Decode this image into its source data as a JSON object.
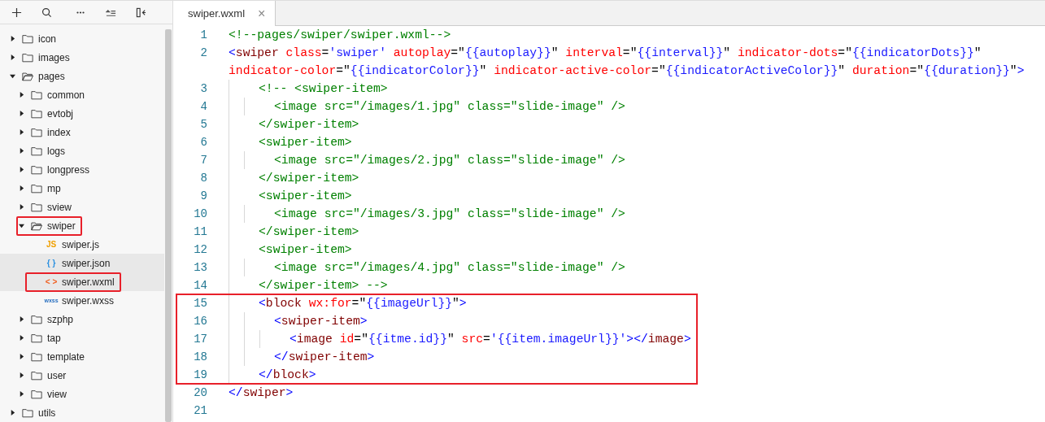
{
  "sidebar": {
    "toolbar": [
      {
        "kind": "add"
      },
      {
        "kind": "search"
      },
      {
        "kind": "more"
      },
      {
        "kind": "collapse"
      },
      {
        "kind": "toggle"
      }
    ],
    "tree": [
      {
        "label": "icon",
        "kind": "folder",
        "expanded": false,
        "selected": false,
        "marked": false
      },
      {
        "label": "images",
        "kind": "folder",
        "expanded": false,
        "selected": false,
        "marked": false
      },
      {
        "label": "pages",
        "kind": "folder",
        "expanded": true,
        "selected": false,
        "marked": false,
        "children": [
          {
            "label": "common",
            "kind": "folder",
            "expanded": false,
            "selected": false,
            "marked": false
          },
          {
            "label": "evtobj",
            "kind": "folder",
            "expanded": false,
            "selected": false,
            "marked": false
          },
          {
            "label": "index",
            "kind": "folder",
            "expanded": false,
            "selected": false,
            "marked": false
          },
          {
            "label": "logs",
            "kind": "folder",
            "expanded": false,
            "selected": false,
            "marked": false
          },
          {
            "label": "longpress",
            "kind": "folder",
            "expanded": false,
            "selected": false,
            "marked": false
          },
          {
            "label": "mp",
            "kind": "folder",
            "expanded": false,
            "selected": false,
            "marked": false
          },
          {
            "label": "sview",
            "kind": "folder",
            "expanded": false,
            "selected": false,
            "marked": false
          },
          {
            "label": "swiper",
            "kind": "folder",
            "expanded": true,
            "selected": false,
            "marked": true,
            "children": [
              {
                "label": "swiper.js",
                "kind": "js",
                "icon": "JS",
                "selected": false,
                "marked": false
              },
              {
                "label": "swiper.json",
                "kind": "json",
                "icon": "{ }",
                "selected": true,
                "marked": false
              },
              {
                "label": "swiper.wxml",
                "kind": "wxml",
                "icon": "< >",
                "selected": true,
                "marked": true
              },
              {
                "label": "swiper.wxss",
                "kind": "wxss",
                "icon": "wxss",
                "selected": false,
                "marked": false
              }
            ]
          },
          {
            "label": "szphp",
            "kind": "folder",
            "expanded": false,
            "selected": false,
            "marked": false
          },
          {
            "label": "tap",
            "kind": "folder",
            "expanded": false,
            "selected": false,
            "marked": false
          },
          {
            "label": "template",
            "kind": "folder",
            "expanded": false,
            "selected": false,
            "marked": false
          },
          {
            "label": "user",
            "kind": "folder",
            "expanded": false,
            "selected": false,
            "marked": false
          },
          {
            "label": "view",
            "kind": "folder",
            "expanded": false,
            "selected": false,
            "marked": false
          }
        ]
      },
      {
        "label": "utils",
        "kind": "folder",
        "expanded": false,
        "selected": false,
        "marked": false
      }
    ]
  },
  "tabs": [
    {
      "label": "swiper.wxml",
      "close": "×",
      "selected": true
    }
  ],
  "editor": {
    "lines": [
      {
        "number": "1",
        "boxed": false,
        "tokens": [
          {
            "kind": "c",
            "text": "<!--pages/swiper/swiper.wxml-->"
          }
        ]
      },
      {
        "number": "2",
        "boxed": false,
        "tokens": [
          {
            "kind": "p",
            "text": "<"
          },
          {
            "kind": "t",
            "text": "swiper"
          },
          {
            "kind": "a",
            "text": " class"
          },
          {
            "kind": "o",
            "text": "="
          },
          {
            "kind": "s",
            "text": "'swiper'"
          },
          {
            "kind": "a",
            "text": " autoplay"
          },
          {
            "kind": "o",
            "text": "=\""
          },
          {
            "kind": "s",
            "text": "{{autoplay}}"
          },
          {
            "kind": "o",
            "text": "\""
          },
          {
            "kind": "a",
            "text": " interval"
          },
          {
            "kind": "o",
            "text": "=\""
          },
          {
            "kind": "s",
            "text": "{{interval}}"
          },
          {
            "kind": "o",
            "text": "\""
          },
          {
            "kind": "a",
            "text": " indicator-dots"
          },
          {
            "kind": "o",
            "text": "=\""
          },
          {
            "kind": "s",
            "text": "{{indicatorDots}}"
          },
          {
            "kind": "o",
            "text": "\""
          },
          {
            "kind": "a",
            "text": " indicator-color"
          },
          {
            "kind": "o",
            "text": "=\""
          },
          {
            "kind": "s",
            "text": "{{indicatorColor}}"
          },
          {
            "kind": "o",
            "text": "\""
          },
          {
            "kind": "a",
            "text": " indicator-active-color"
          },
          {
            "kind": "o",
            "text": "=\""
          },
          {
            "kind": "s",
            "text": "{{indicatorActiveColor}}"
          },
          {
            "kind": "o",
            "text": "\""
          },
          {
            "kind": "a",
            "text": " duration"
          },
          {
            "kind": "o",
            "text": "=\""
          },
          {
            "kind": "s",
            "text": "{{duration}}"
          },
          {
            "kind": "o",
            "text": "\""
          },
          {
            "kind": "p",
            "text": ">"
          }
        ]
      },
      {
        "number": "3",
        "boxed": false,
        "tokens": [
          {
            "kind": "c",
            "text": "    <!-- <swiper-item>"
          }
        ]
      },
      {
        "number": "4",
        "boxed": false,
        "tokens": [
          {
            "kind": "c",
            "text": "      <image src=\"/images/1.jpg\" class=\"slide-image\" />"
          }
        ]
      },
      {
        "number": "5",
        "boxed": false,
        "tokens": [
          {
            "kind": "c",
            "text": "    </swiper-item>"
          }
        ]
      },
      {
        "number": "6",
        "boxed": false,
        "tokens": [
          {
            "kind": "c",
            "text": "    <swiper-item>"
          }
        ]
      },
      {
        "number": "7",
        "boxed": false,
        "tokens": [
          {
            "kind": "c",
            "text": "      <image src=\"/images/2.jpg\" class=\"slide-image\" />"
          }
        ]
      },
      {
        "number": "8",
        "boxed": false,
        "tokens": [
          {
            "kind": "c",
            "text": "    </swiper-item>"
          }
        ]
      },
      {
        "number": "9",
        "boxed": false,
        "tokens": [
          {
            "kind": "c",
            "text": "    <swiper-item>"
          }
        ]
      },
      {
        "number": "10",
        "boxed": false,
        "tokens": [
          {
            "kind": "c",
            "text": "      <image src=\"/images/3.jpg\" class=\"slide-image\" />"
          }
        ]
      },
      {
        "number": "11",
        "boxed": false,
        "tokens": [
          {
            "kind": "c",
            "text": "    </swiper-item>"
          }
        ]
      },
      {
        "number": "12",
        "boxed": false,
        "tokens": [
          {
            "kind": "c",
            "text": "    <swiper-item>"
          }
        ]
      },
      {
        "number": "13",
        "boxed": false,
        "tokens": [
          {
            "kind": "c",
            "text": "      <image src=\"/images/4.jpg\" class=\"slide-image\" />"
          }
        ]
      },
      {
        "number": "14",
        "boxed": false,
        "tokens": [
          {
            "kind": "c",
            "text": "    </swiper-item> -->"
          }
        ]
      },
      {
        "number": "15",
        "boxed": true,
        "tokens": [
          {
            "kind": "p",
            "text": "    <"
          },
          {
            "kind": "t",
            "text": "block"
          },
          {
            "kind": "a",
            "text": " wx:for"
          },
          {
            "kind": "o",
            "text": "=\""
          },
          {
            "kind": "s",
            "text": "{{imageUrl}}"
          },
          {
            "kind": "o",
            "text": "\""
          },
          {
            "kind": "p",
            "text": ">"
          }
        ]
      },
      {
        "number": "16",
        "boxed": true,
        "tokens": [
          {
            "kind": "p",
            "text": "      <"
          },
          {
            "kind": "t",
            "text": "swiper-item"
          },
          {
            "kind": "p",
            "text": ">"
          }
        ]
      },
      {
        "number": "17",
        "boxed": true,
        "tokens": [
          {
            "kind": "p",
            "text": "        <"
          },
          {
            "kind": "t",
            "text": "image"
          },
          {
            "kind": "a",
            "text": " id"
          },
          {
            "kind": "o",
            "text": "=\""
          },
          {
            "kind": "s",
            "text": "{{itme.id}}"
          },
          {
            "kind": "o",
            "text": "\""
          },
          {
            "kind": "a",
            "text": " src"
          },
          {
            "kind": "o",
            "text": "="
          },
          {
            "kind": "s",
            "text": "'{{item.imageUrl}}'"
          },
          {
            "kind": "p",
            "text": "></"
          },
          {
            "kind": "t",
            "text": "image"
          },
          {
            "kind": "p",
            "text": ">"
          }
        ]
      },
      {
        "number": "18",
        "boxed": true,
        "tokens": [
          {
            "kind": "p",
            "text": "      </"
          },
          {
            "kind": "t",
            "text": "swiper-item"
          },
          {
            "kind": "p",
            "text": ">"
          }
        ]
      },
      {
        "number": "19",
        "boxed": true,
        "tokens": [
          {
            "kind": "p",
            "text": "    </"
          },
          {
            "kind": "t",
            "text": "block"
          },
          {
            "kind": "p",
            "text": ">"
          }
        ]
      },
      {
        "number": "20",
        "boxed": false,
        "tokens": [
          {
            "kind": "p",
            "text": "</"
          },
          {
            "kind": "t",
            "text": "swiper"
          },
          {
            "kind": "p",
            "text": ">"
          }
        ]
      },
      {
        "number": "21",
        "boxed": false
      }
    ]
  }
}
